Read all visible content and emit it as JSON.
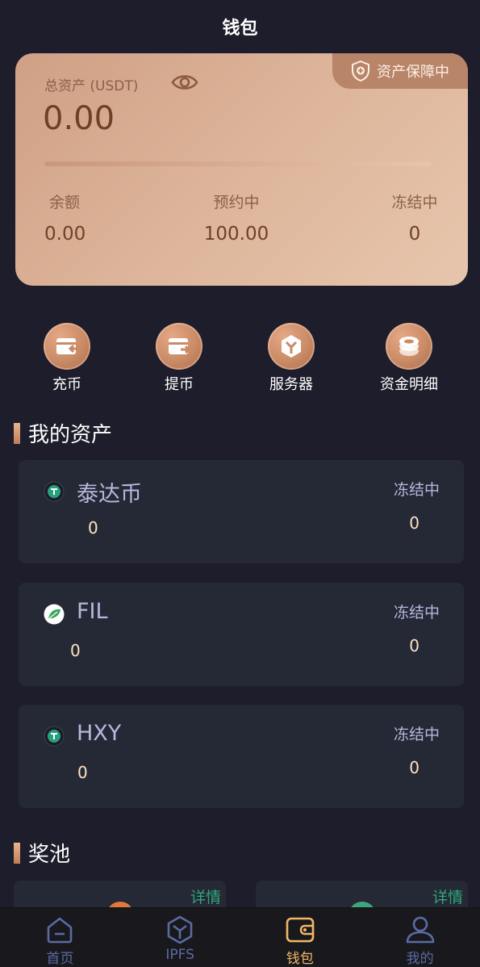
{
  "header": {
    "title": "钱包"
  },
  "card": {
    "badge": "资产保障中",
    "total_label": "总资产 (USDT)",
    "total_value": "0.00",
    "stats": [
      {
        "label": "余额",
        "value": "0.00"
      },
      {
        "label": "预约中",
        "value": "100.00"
      },
      {
        "label": "冻结中",
        "value": "0"
      }
    ]
  },
  "actions": [
    {
      "label": "充币",
      "icon": "deposit-icon"
    },
    {
      "label": "提币",
      "icon": "withdraw-icon"
    },
    {
      "label": "服务器",
      "icon": "server-icon"
    },
    {
      "label": "资金明细",
      "icon": "coins-icon"
    }
  ],
  "assets_section": {
    "title": "我的资产"
  },
  "assets": [
    {
      "name": "泰达币",
      "amount": "0",
      "frozen_label": "冻结中",
      "frozen_value": "0",
      "icon": "tether-icon"
    },
    {
      "name": "FIL",
      "amount": "0",
      "frozen_label": "冻结中",
      "frozen_value": "0",
      "icon": "fil-leaf-icon"
    },
    {
      "name": "HXY",
      "amount": "0",
      "frozen_label": "冻结中",
      "frozen_value": "0",
      "icon": "tether-icon"
    }
  ],
  "pool_section": {
    "title": "奖池"
  },
  "pools": [
    {
      "detail_label": "详情",
      "color": "#e0793a"
    },
    {
      "detail_label": "详情",
      "color": "#3fa57f"
    }
  ],
  "tabbar": [
    {
      "label": "首页",
      "icon": "home-icon"
    },
    {
      "label": "IPFS",
      "icon": "ipfs-icon"
    },
    {
      "label": "钱包",
      "icon": "wallet-icon",
      "active": true
    },
    {
      "label": "我的",
      "icon": "user-icon"
    }
  ],
  "colors": {
    "accent": "#f0b766",
    "background": "#1d1d2b",
    "card_panel": "#252936",
    "green": "#2fa77a"
  }
}
